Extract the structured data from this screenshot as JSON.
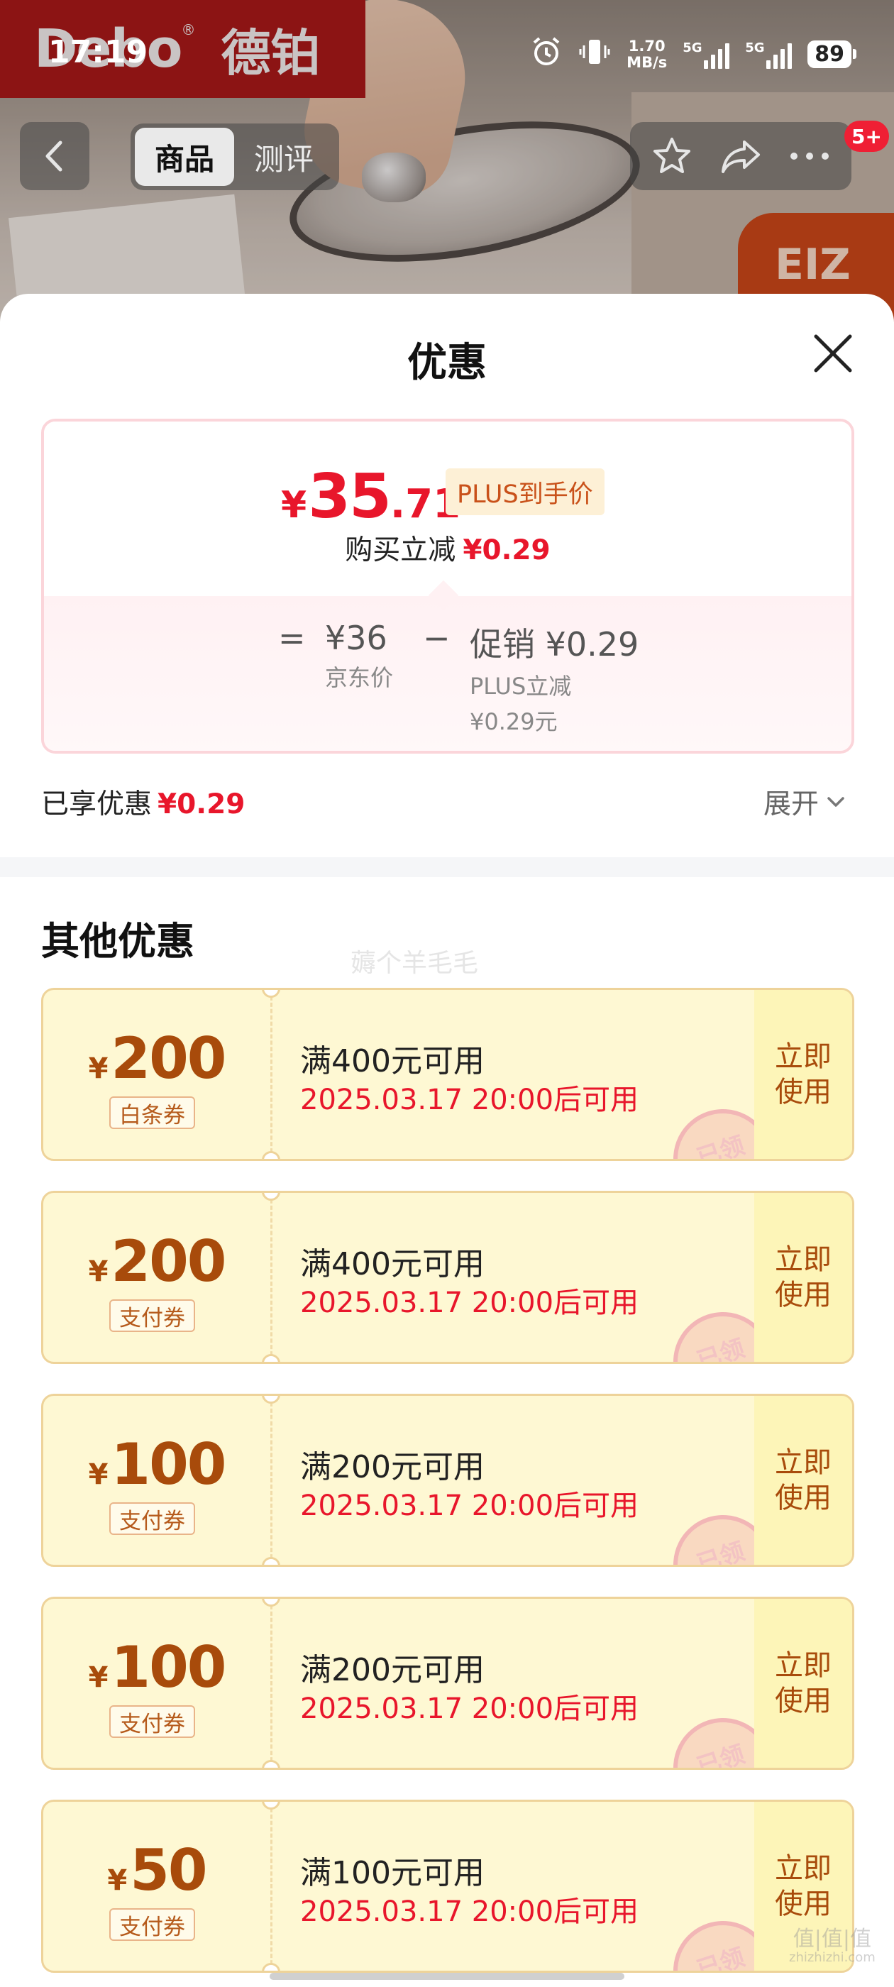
{
  "status_bar": {
    "time": "17:19",
    "net_speed_value": "1.70",
    "net_speed_unit": "MB/s",
    "sim1_label": "5G",
    "sim2_label": "5G",
    "battery": "89"
  },
  "hero": {
    "brand_en": "Debo",
    "brand_reg": "®",
    "brand_cn": "德铂"
  },
  "nav": {
    "tabs": [
      "商品",
      "测评"
    ],
    "more_badge": "5+"
  },
  "sheet": {
    "title": "优惠",
    "price": {
      "symbol": "¥",
      "integer": "35",
      "decimal": ".71",
      "plus_tag": "PLUS到手价",
      "buy_label": "购买立减",
      "buy_value": "¥0.29"
    },
    "calc": {
      "equals": "=",
      "jd_value": "¥36",
      "jd_label": "京东价",
      "minus": "−",
      "promo_value": "促销 ¥0.29",
      "promo_line1": "PLUS立减",
      "promo_line2": "¥0.29元"
    },
    "enjoyed_label": "已享优惠",
    "enjoyed_value": "¥0.29",
    "expand_label": "展开",
    "other_title": "其他优惠",
    "coupons": [
      {
        "symbol": "¥",
        "amount": "200",
        "type": "白条券",
        "condition": "满400元可用",
        "time": "2025.03.17 20:00后可用",
        "stamp": "已领",
        "action_line1": "立即",
        "action_line2": "使用"
      },
      {
        "symbol": "¥",
        "amount": "200",
        "type": "支付券",
        "condition": "满400元可用",
        "time": "2025.03.17 20:00后可用",
        "stamp": "已领",
        "action_line1": "立即",
        "action_line2": "使用"
      },
      {
        "symbol": "¥",
        "amount": "100",
        "type": "支付券",
        "condition": "满200元可用",
        "time": "2025.03.17 20:00后可用",
        "stamp": "已领",
        "action_line1": "立即",
        "action_line2": "使用"
      },
      {
        "symbol": "¥",
        "amount": "100",
        "type": "支付券",
        "condition": "满200元可用",
        "time": "2025.03.17 20:00后可用",
        "stamp": "已领",
        "action_line1": "立即",
        "action_line2": "使用"
      },
      {
        "symbol": "¥",
        "amount": "50",
        "type": "支付券",
        "condition": "满100元可用",
        "time": "2025.03.17 20:00后可用",
        "stamp": "已领",
        "action_line1": "立即",
        "action_line2": "使用"
      }
    ]
  },
  "watermarks": {
    "middle": "薅个羊毛毛",
    "corner_main": "值|值|值",
    "corner_sub": "zhizhizhi.com"
  },
  "colors": {
    "accent_red": "#e8162b",
    "coupon_bg": "#fef8d3",
    "coupon_text": "#a84b0b",
    "brand_red": "#8c1414"
  }
}
